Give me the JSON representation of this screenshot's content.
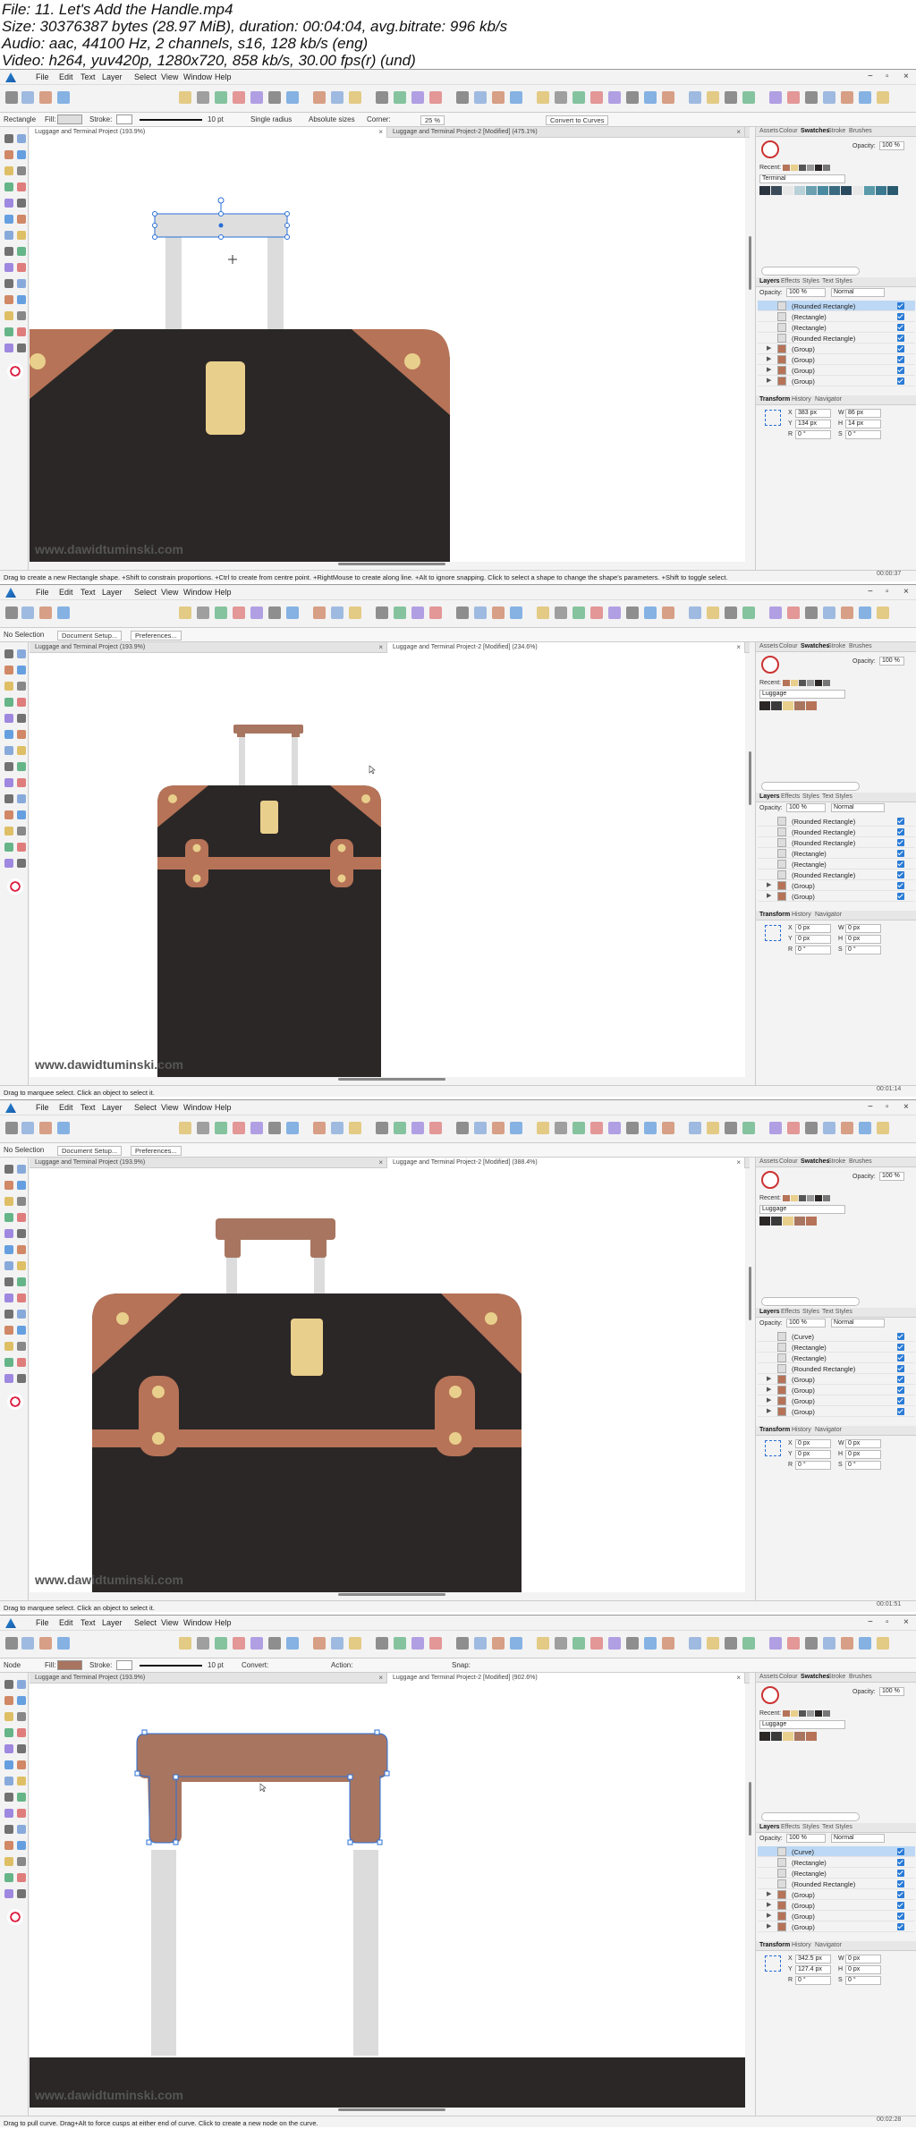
{
  "file_info": {
    "file": "File: 11. Let's Add the Handle.mp4",
    "size": "Size: 30376387 bytes (28.97 MiB), duration: 00:04:04, avg.bitrate: 996 kb/s",
    "audio": "Audio: aac, 44100 Hz, 2 channels, s16, 128 kb/s (eng)",
    "video": "Video: h264, yuv420p, 1280x720, 858 kb/s, 30.00 fps(r) (und)"
  },
  "menu": [
    "File",
    "Edit",
    "Text",
    "Layer",
    "Select",
    "View",
    "Window",
    "Help"
  ],
  "window_controls": {
    "minimize": "−",
    "maximize": "▫",
    "close": "×"
  },
  "watermark": "www.dawidtuminski.com",
  "colors": {
    "brown": "#b67357",
    "dark": "#2b2727",
    "yellow": "#e9cf8c",
    "handle": "#a87560",
    "pole": "#dcdcdc",
    "selection": "#2a6fd6"
  },
  "frames": [
    {
      "context": {
        "tool": "Rectangle",
        "fill_label": "Fill:",
        "stroke_label": "Stroke:",
        "stroke_width": "10 pt",
        "single_radius": "Single radius",
        "absolute_sizes": "Absolute sizes",
        "corner_label": "Corner:",
        "corner_value": "25 %",
        "convert": "Convert to Curves"
      },
      "tabs": [
        {
          "label": "Luggage and Terminal Project (193.9%)",
          "active": true
        },
        {
          "label": "Luggage and Terminal Project-2 [Modified] (475.1%)",
          "active": false
        }
      ],
      "status": "Drag to create a new Rectangle shape. +Shift to constrain proportions. +Ctrl to create from centre point. +RightMouse to create along line. +Alt to ignore snapping. Click to select a shape to change the shape's parameters. +Shift to toggle select.",
      "panel": {
        "top_tabs": [
          "Assets",
          "Colour",
          "Swatches",
          "Stroke",
          "Brushes"
        ],
        "opacity_label": "Opacity:",
        "opacity": "100 %",
        "recent": "Recent:",
        "palette": "Terminal",
        "layer_tabs": [
          "Layers",
          "Effects",
          "Styles",
          "Text Styles"
        ],
        "layer_opacity": "100 %",
        "blend": "Normal",
        "layers": [
          {
            "name": "(Rounded Rectangle)",
            "group": false,
            "sel": true
          },
          {
            "name": "(Rectangle)",
            "group": false,
            "sel": false
          },
          {
            "name": "(Rectangle)",
            "group": false,
            "sel": false
          },
          {
            "name": "(Rounded Rectangle)",
            "group": false,
            "sel": false
          },
          {
            "name": "(Group)",
            "group": true,
            "sel": false
          },
          {
            "name": "(Group)",
            "group": true,
            "sel": false
          },
          {
            "name": "(Group)",
            "group": true,
            "sel": false
          },
          {
            "name": "(Group)",
            "group": true,
            "sel": false
          }
        ],
        "bottom_tabs": [
          "Transform",
          "History",
          "Navigator"
        ],
        "transform": {
          "x": "383 px",
          "y": "134 px",
          "w": "86 px",
          "h": "14 px",
          "r": "0 °",
          "s": "0 °"
        }
      }
    },
    {
      "context": {
        "tool": "No Selection",
        "doc_setup": "Document Setup...",
        "prefs": "Preferences..."
      },
      "tabs": [
        {
          "label": "Luggage and Terminal Project (193.9%)",
          "active": false
        },
        {
          "label": "Luggage and Terminal Project-2 [Modified] (234.6%)",
          "active": true
        }
      ],
      "status": "Drag to marquee select. Click an object to select it.",
      "panel": {
        "top_tabs": [
          "Assets",
          "Colour",
          "Swatches",
          "Stroke",
          "Brushes"
        ],
        "opacity_label": "Opacity:",
        "opacity": "100 %",
        "recent": "Recent:",
        "palette": "Luggage",
        "layer_tabs": [
          "Layers",
          "Effects",
          "Styles",
          "Text Styles"
        ],
        "layer_opacity": "100 %",
        "blend": "Normal",
        "layers": [
          {
            "name": "(Rounded Rectangle)",
            "group": false,
            "sel": false
          },
          {
            "name": "(Rounded Rectangle)",
            "group": false,
            "sel": false
          },
          {
            "name": "(Rounded Rectangle)",
            "group": false,
            "sel": false
          },
          {
            "name": "(Rectangle)",
            "group": false,
            "sel": false
          },
          {
            "name": "(Rectangle)",
            "group": false,
            "sel": false
          },
          {
            "name": "(Rounded Rectangle)",
            "group": false,
            "sel": false
          },
          {
            "name": "(Group)",
            "group": true,
            "sel": false
          },
          {
            "name": "(Group)",
            "group": true,
            "sel": false
          }
        ],
        "bottom_tabs": [
          "Transform",
          "History",
          "Navigator"
        ],
        "transform": {
          "x": "0 px",
          "y": "0 px",
          "w": "0 px",
          "h": "0 px",
          "r": "0 °",
          "s": "0 °"
        }
      }
    },
    {
      "context": {
        "tool": "No Selection",
        "doc_setup": "Document Setup...",
        "prefs": "Preferences..."
      },
      "tabs": [
        {
          "label": "Luggage and Terminal Project (193.9%)",
          "active": false
        },
        {
          "label": "Luggage and Terminal Project-2 [Modified] (388.4%)",
          "active": true
        }
      ],
      "status": "Drag to marquee select. Click an object to select it.",
      "panel": {
        "top_tabs": [
          "Assets",
          "Colour",
          "Swatches",
          "Stroke",
          "Brushes"
        ],
        "opacity_label": "Opacity:",
        "opacity": "100 %",
        "recent": "Recent:",
        "palette": "Luggage",
        "layer_tabs": [
          "Layers",
          "Effects",
          "Styles",
          "Text Styles"
        ],
        "layer_opacity": "100 %",
        "blend": "Normal",
        "layers": [
          {
            "name": "(Curve)",
            "group": false,
            "sel": false
          },
          {
            "name": "(Rectangle)",
            "group": false,
            "sel": false
          },
          {
            "name": "(Rectangle)",
            "group": false,
            "sel": false
          },
          {
            "name": "(Rounded Rectangle)",
            "group": false,
            "sel": false
          },
          {
            "name": "(Group)",
            "group": true,
            "sel": false
          },
          {
            "name": "(Group)",
            "group": true,
            "sel": false
          },
          {
            "name": "(Group)",
            "group": true,
            "sel": false
          },
          {
            "name": "(Group)",
            "group": true,
            "sel": false
          }
        ],
        "bottom_tabs": [
          "Transform",
          "History",
          "Navigator"
        ],
        "transform": {
          "x": "0 px",
          "y": "0 px",
          "w": "0 px",
          "h": "0 px",
          "r": "0 °",
          "s": "0 °"
        }
      }
    },
    {
      "context": {
        "tool": "Node",
        "fill_label": "Fill:",
        "stroke_label": "Stroke:",
        "stroke_width": "10 pt",
        "convert_label": "Convert:",
        "action_label": "Action:",
        "snap_label": "Snap:"
      },
      "tabs": [
        {
          "label": "Luggage and Terminal Project (193.9%)",
          "active": false
        },
        {
          "label": "Luggage and Terminal Project-2 [Modified] (902.6%)",
          "active": true
        }
      ],
      "status": "Drag to pull curve. Drag+Alt to force cusps at either end of curve. Click to create a new node on the curve.",
      "panel": {
        "top_tabs": [
          "Assets",
          "Colour",
          "Swatches",
          "Stroke",
          "Brushes"
        ],
        "opacity_label": "Opacity:",
        "opacity": "100 %",
        "recent": "Recent:",
        "palette": "Luggage",
        "layer_tabs": [
          "Layers",
          "Effects",
          "Styles",
          "Text Styles"
        ],
        "layer_opacity": "100 %",
        "blend": "Normal",
        "layers": [
          {
            "name": "(Curve)",
            "group": false,
            "sel": true
          },
          {
            "name": "(Rectangle)",
            "group": false,
            "sel": false
          },
          {
            "name": "(Rectangle)",
            "group": false,
            "sel": false
          },
          {
            "name": "(Rounded Rectangle)",
            "group": false,
            "sel": false
          },
          {
            "name": "(Group)",
            "group": true,
            "sel": false
          },
          {
            "name": "(Group)",
            "group": true,
            "sel": false
          },
          {
            "name": "(Group)",
            "group": true,
            "sel": false
          },
          {
            "name": "(Group)",
            "group": true,
            "sel": false
          }
        ],
        "bottom_tabs": [
          "Transform",
          "History",
          "Navigator"
        ],
        "transform": {
          "x": "342.5 px",
          "y": "127.4 px",
          "w": "0 px",
          "h": "0 px",
          "r": "0 °",
          "s": "0 °"
        }
      }
    }
  ],
  "timestamps": [
    "00:00:37",
    "00:01:14",
    "00:01:51",
    "00:02:28"
  ]
}
